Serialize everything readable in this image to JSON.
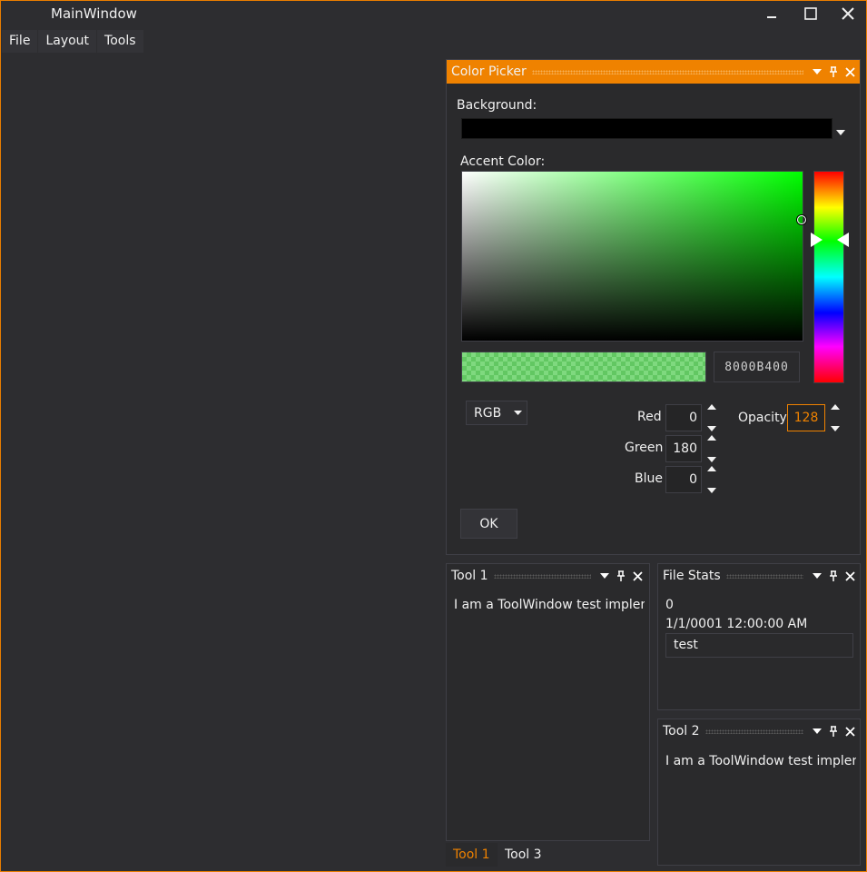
{
  "window": {
    "title": "MainWindow"
  },
  "menu": {
    "items": [
      "File",
      "Layout",
      "Tools"
    ]
  },
  "color_picker": {
    "title": "Color Picker",
    "background_label": "Background:",
    "accent_label": "Accent Color:",
    "hex_value": "8000B400",
    "mode": "RGB",
    "red_label": "Red",
    "red_value": "0",
    "green_label": "Green",
    "green_value": "180",
    "blue_label": "Blue",
    "blue_value": "0",
    "opacity_label": "Opacity",
    "opacity_value": "128",
    "ok_label": "OK",
    "accent_color": "#00B400"
  },
  "tool1": {
    "title": "Tool 1",
    "content": "I am a ToolWindow test implem"
  },
  "file_stats": {
    "title": "File Stats",
    "count": "0",
    "date": "1/1/0001 12:00:00 AM",
    "input_value": "test"
  },
  "tool2": {
    "title": "Tool 2",
    "content": "I am a ToolWindow test implem"
  },
  "tabs": {
    "tab1": "Tool 1",
    "tab2": "Tool 3"
  },
  "colors": {
    "accent": "#EF8200",
    "background": "#2D2D30"
  }
}
